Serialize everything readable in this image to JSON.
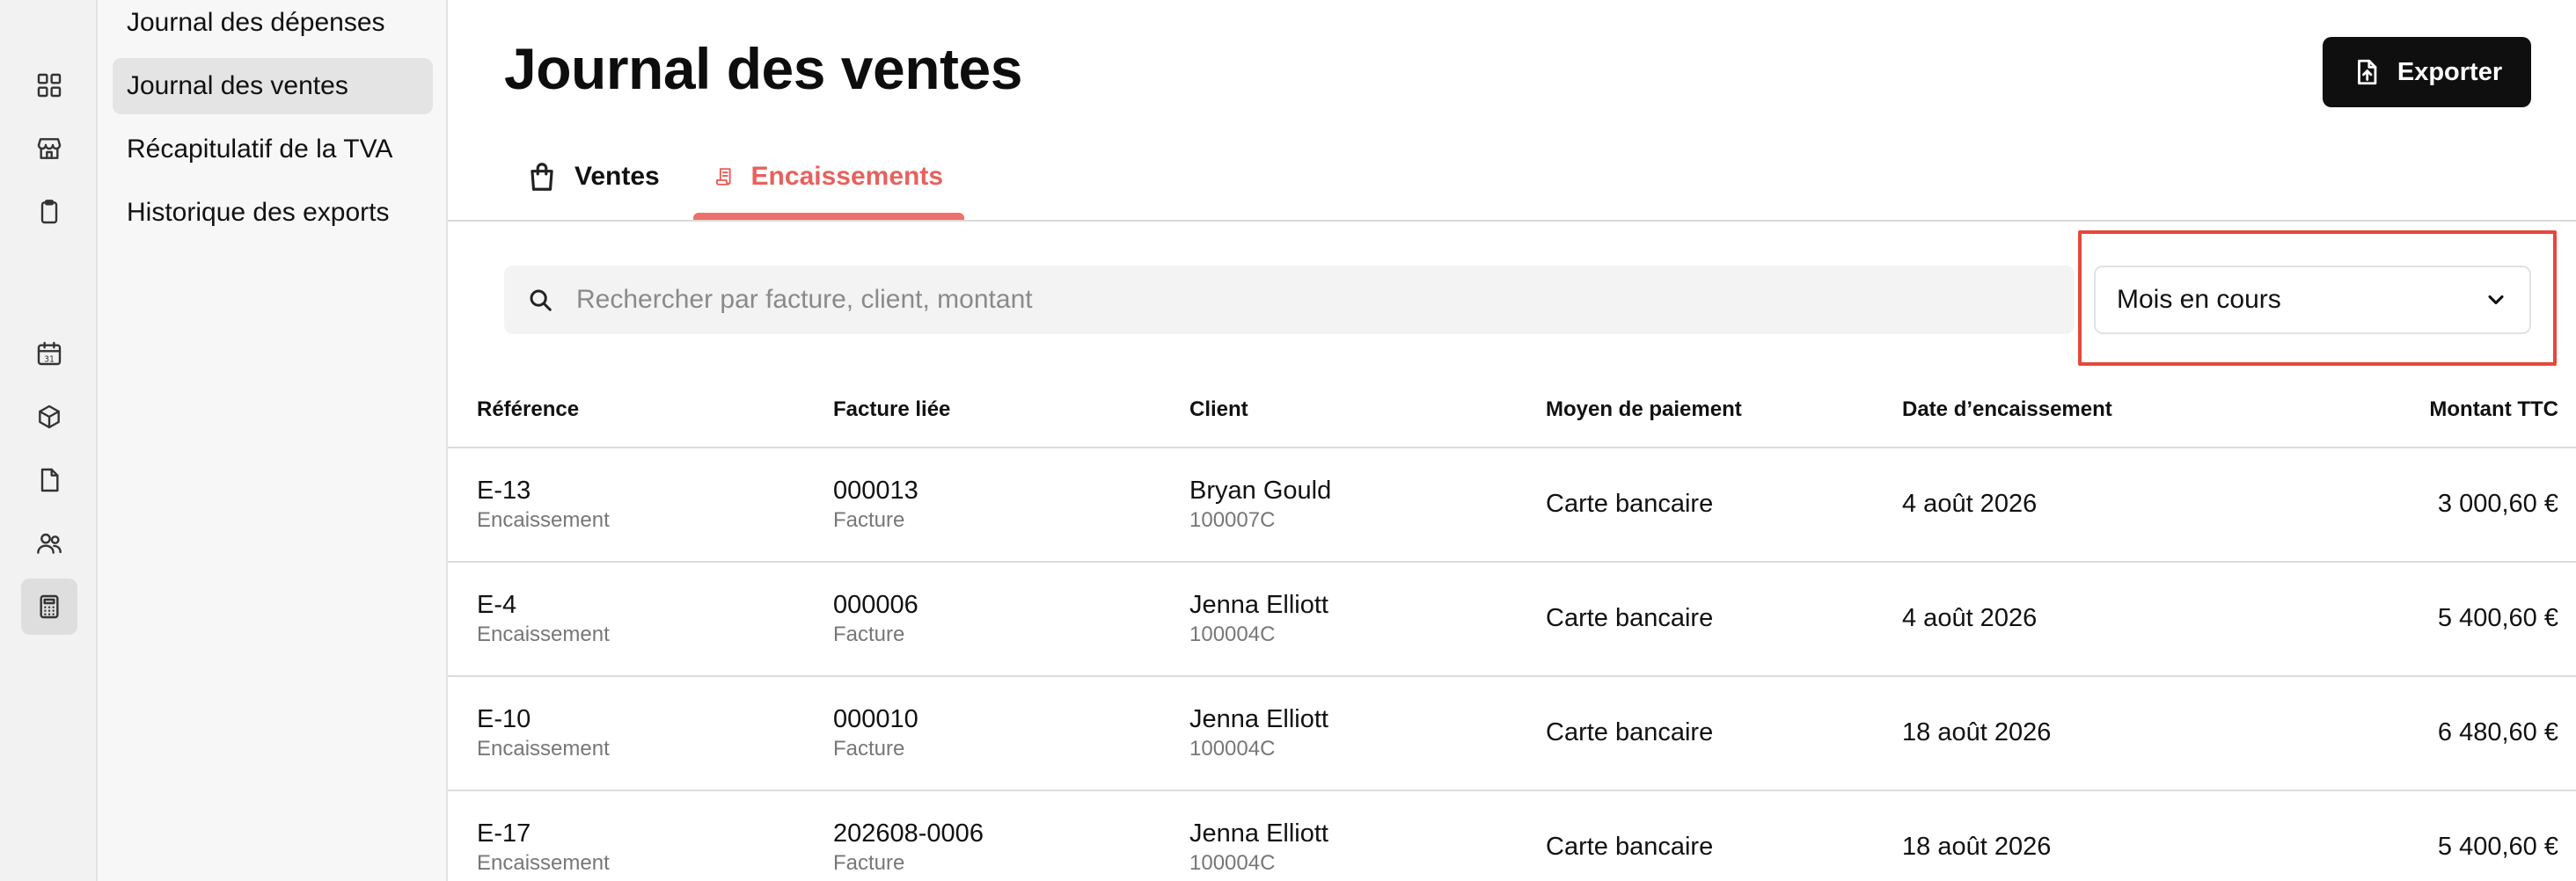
{
  "rail": {
    "icons": [
      "dashboard-icon",
      "store-icon",
      "clipboard-icon",
      "calendar-icon",
      "box-icon",
      "document-icon",
      "users-icon",
      "calculator-icon"
    ],
    "calendar_day": "31"
  },
  "subnav": {
    "items": [
      {
        "label": "Journal des dépenses"
      },
      {
        "label": "Journal des ventes"
      },
      {
        "label": "Récapitulatif de la TVA"
      },
      {
        "label": "Historique des exports"
      }
    ]
  },
  "page": {
    "title": "Journal des ventes",
    "export_label": "Exporter"
  },
  "tabs": [
    {
      "label": "Ventes"
    },
    {
      "label": "Encaissements"
    }
  ],
  "search": {
    "placeholder": "Rechercher par facture, client, montant"
  },
  "period": {
    "selected": "Mois en cours"
  },
  "table": {
    "headers": [
      "Référence",
      "Facture liée",
      "Client",
      "Moyen de paiement",
      "Date d’encaissement",
      "Montant TTC"
    ],
    "rows": [
      {
        "ref": "E-13",
        "ref_type": "Encaissement",
        "invoice": "000013",
        "invoice_type": "Facture",
        "client": "Bryan Gould",
        "client_code": "100007C",
        "payment": "Carte bancaire",
        "date": "4 août 2026",
        "amount": "3 000,60 €"
      },
      {
        "ref": "E-4",
        "ref_type": "Encaissement",
        "invoice": "000006",
        "invoice_type": "Facture",
        "client": "Jenna Elliott",
        "client_code": "100004C",
        "payment": "Carte bancaire",
        "date": "4 août 2026",
        "amount": "5 400,60 €"
      },
      {
        "ref": "E-10",
        "ref_type": "Encaissement",
        "invoice": "000010",
        "invoice_type": "Facture",
        "client": "Jenna Elliott",
        "client_code": "100004C",
        "payment": "Carte bancaire",
        "date": "18 août 2026",
        "amount": "6 480,60 €"
      },
      {
        "ref": "E-17",
        "ref_type": "Encaissement",
        "invoice": "202608-0006",
        "invoice_type": "Facture",
        "client": "Jenna Elliott",
        "client_code": "100004C",
        "payment": "Carte bancaire",
        "date": "18 août 2026",
        "amount": "5 400,60 €"
      }
    ]
  },
  "colors": {
    "accent": "#e8615d",
    "highlight": "#e5483b",
    "button_bg": "#0f0f0f"
  }
}
